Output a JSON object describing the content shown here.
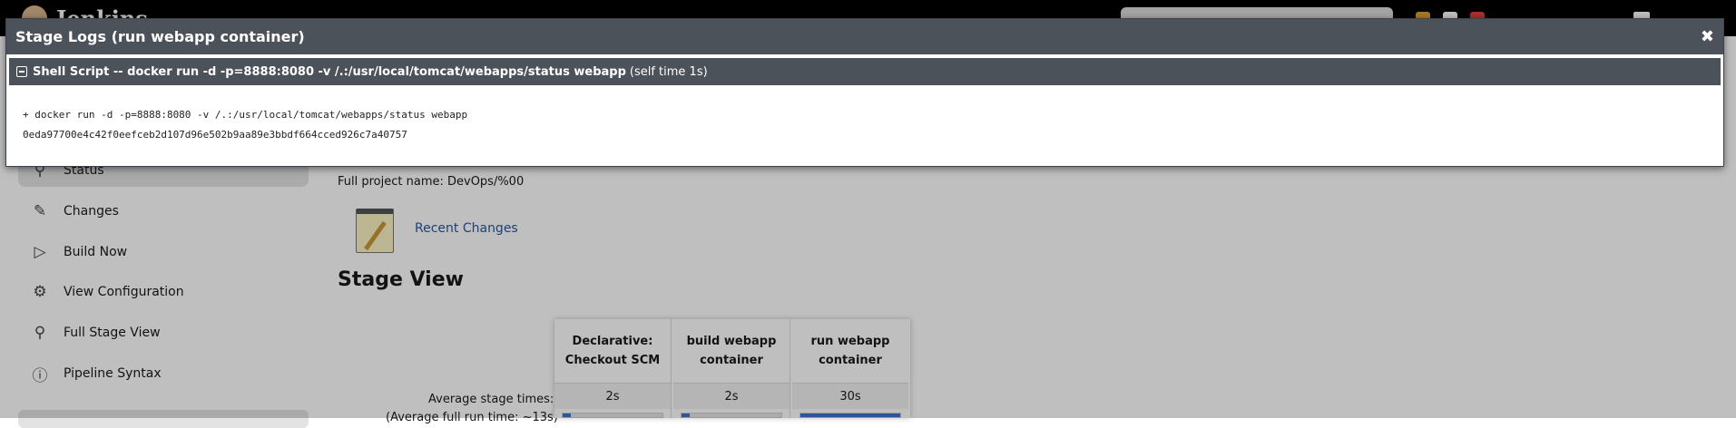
{
  "header": {
    "app_name": "Jenkins"
  },
  "sidebar": {
    "items": [
      {
        "label": "Status",
        "icon": "search-icon"
      },
      {
        "label": "Changes",
        "icon": "notepad-icon"
      },
      {
        "label": "Build Now",
        "icon": "play-icon"
      },
      {
        "label": "View Configuration",
        "icon": "gear-icon"
      },
      {
        "label": "Full Stage View",
        "icon": "search-icon"
      },
      {
        "label": "Pipeline Syntax",
        "icon": "help-icon"
      }
    ]
  },
  "main": {
    "full_project_name": "Full project name: DevOps/%00",
    "recent_changes_label": "Recent Changes",
    "stage_view_title": "Stage View",
    "stage_table": {
      "avg_label": "Average stage times:",
      "avg_full_label": "(Average full run time: ~13s)",
      "stages": [
        {
          "name": "Declarative: Checkout SCM",
          "time": "2s",
          "progress": 0.08
        },
        {
          "name": "build webapp container",
          "time": "2s",
          "progress": 0.08
        },
        {
          "name": "run webapp container",
          "time": "30s",
          "progress": 1.0
        }
      ]
    }
  },
  "modal": {
    "title": "Stage Logs (run webapp container)",
    "close_glyph": "✖",
    "step": {
      "label": "Shell Script -- docker run -d -p=8888:8080 -v /.:/usr/local/tomcat/webapps/status webapp",
      "meta": "(self time 1s)"
    },
    "log_lines": [
      "+ docker run -d -p=8888:8080 -v /.:/usr/local/tomcat/webapps/status webapp",
      "0eda97700e4c42f0eefceb2d107d96e502b9aa89e3bbdf664cced926c7a40757"
    ]
  }
}
